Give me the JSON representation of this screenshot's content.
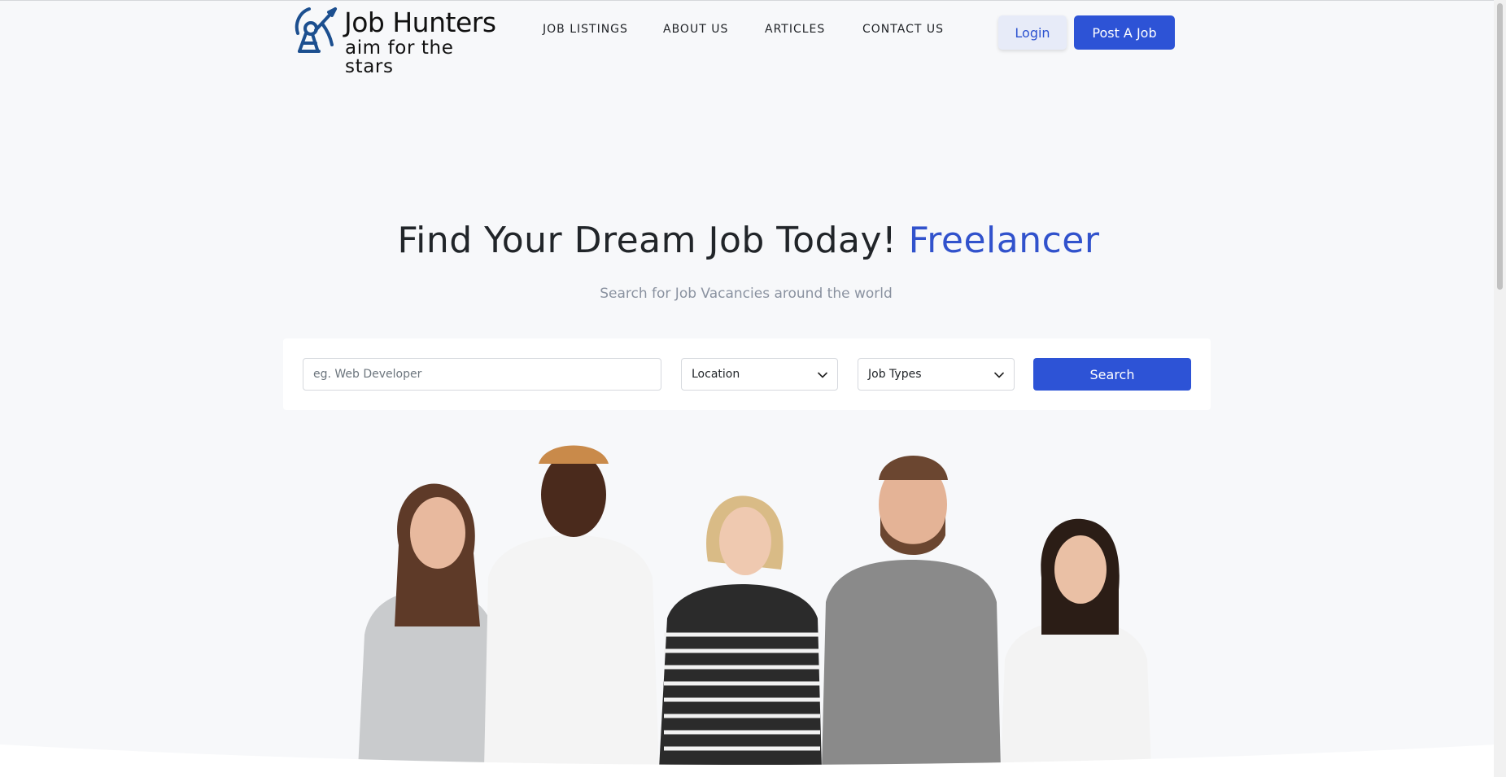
{
  "brand": {
    "name": "Job Hunters",
    "tagline": "aim for the stars",
    "logo_icon": "rocket-astronaut-icon"
  },
  "nav": {
    "items": [
      {
        "label": "JOB LISTINGS"
      },
      {
        "label": "ABOUT US"
      },
      {
        "label": "ARTICLES"
      },
      {
        "label": "CONTACT US"
      }
    ],
    "login_label": "Login",
    "post_job_label": "Post A Job"
  },
  "hero": {
    "title": "Find Your Dream Job Today!",
    "title_accent": "Freelancer",
    "subtitle": "Search for Job Vacancies around the world"
  },
  "search": {
    "placeholder": "eg. Web Developer",
    "value": "",
    "location_label": "Location",
    "job_types_label": "Job Types",
    "button_label": "Search"
  },
  "colors": {
    "primary": "#2d53d6",
    "accent_text": "#3152cc",
    "background": "#f7f8fa",
    "login_bg": "#e7ebf8"
  },
  "illustration": {
    "name": "group-of-smiling-people-image"
  }
}
